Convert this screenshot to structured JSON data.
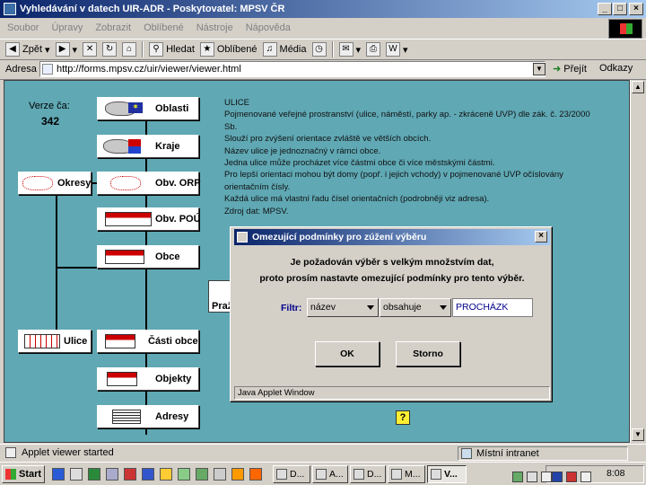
{
  "window": {
    "title": "Vyhledávání v datech UIR-ADR - Poskytovatel: MPSV ČR",
    "min": "_",
    "max": "□",
    "close": "×"
  },
  "menu": [
    "Soubor",
    "Úpravy",
    "Zobrazit",
    "Oblíbené",
    "Nástroje",
    "Nápověda"
  ],
  "toolbar": {
    "back": "Zpět",
    "search": "Hledat",
    "favorites": "Oblíbené",
    "media": "Média"
  },
  "address": {
    "label": "Adresa",
    "url": "http://forms.mpsv.cz/uir/viewer/viewer.html",
    "go": "Přejít",
    "links": "Odkazy"
  },
  "nav": {
    "version_label": "Verze ča:",
    "version_value": "342",
    "buttons": {
      "oblasti": "Oblasti",
      "kraje": "Kraje",
      "okresy": "Okresy",
      "orp": "Obv. ORP",
      "pou": "Obv. POÚ",
      "obce": "Obce",
      "ulice": "Ulice",
      "casti": "Části obce",
      "objekty": "Objekty",
      "adresy": "Adresy",
      "hidden": "Praž"
    },
    "help": "?"
  },
  "info": [
    "ULICE",
    "Pojmenované veřejné prostranství (ulice, náměstí, parky ap. - zkráceně UVP) dle zák. č. 23/2000",
    "Sb.",
    "Slouží pro zvýšení orientace zvláště ve větších obcích.",
    "Název ulice je jednoznačný v rámci obce.",
    "Jedna ulice může procházet více částmi obce či více městskými částmi.",
    "Pro lepší orientaci mohou být domy (popř. i jejich vchody) v pojmenované UVP očíslovány",
    "orientačním čísly.",
    "Každá ulice má vlastní řadu čísel orientačních (podrobněji viz adresa).",
    "Zdroj dat: MPSV."
  ],
  "dialog": {
    "title": "Omezující podmínky pro zúžení výběru",
    "close": "×",
    "line1": "Je požadován výběr s velkým množstvím dat,",
    "line2": "proto prosím nastavte omezující podmínky pro tento výběr.",
    "filter_label": "Filtr:",
    "field_value": "název",
    "operator_value": "obsahuje",
    "filter_value": "PROCHÁZK",
    "ok": "OK",
    "cancel": "Storno",
    "java_notice": "Java Applet Window"
  },
  "status": {
    "text": "Applet viewer started",
    "zone": "Místní intranet"
  },
  "taskbar": {
    "start": "Start",
    "tasks": [
      "D...",
      "A...",
      "D...",
      "M...",
      "V..."
    ],
    "clock": "8:08"
  }
}
